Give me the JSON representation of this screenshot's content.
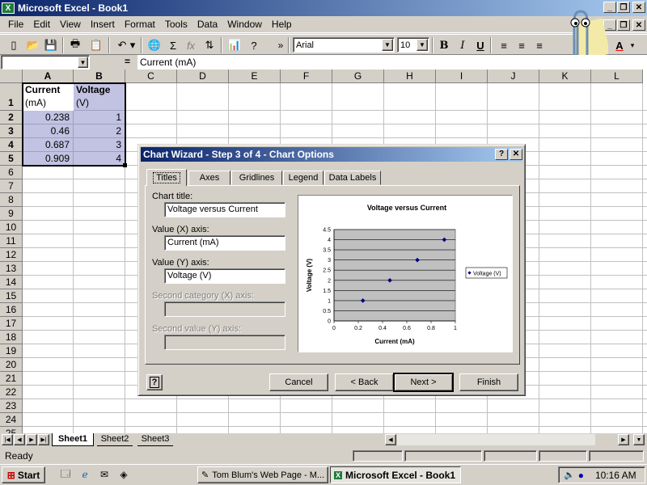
{
  "window": {
    "title": "Microsoft Excel - Book1"
  },
  "menu": [
    "File",
    "Edit",
    "View",
    "Insert",
    "Format",
    "Tools",
    "Data",
    "Window",
    "Help"
  ],
  "toolbar": {
    "font": "Arial",
    "size": "10",
    "bold": "B",
    "italic": "I",
    "underline": "U",
    "sigma": "Σ",
    "fx": "fx",
    "overflow": "»"
  },
  "formula": {
    "name_box": "",
    "equals": "=",
    "content": "Current (mA)"
  },
  "sheet": {
    "columns": [
      "A",
      "B",
      "C",
      "D",
      "E",
      "F",
      "G",
      "H",
      "I",
      "J",
      "K",
      "L"
    ],
    "rows": [
      "1",
      "2",
      "3",
      "4",
      "5",
      "6",
      "7",
      "8",
      "9",
      "10",
      "11",
      "12",
      "13",
      "14",
      "15",
      "16",
      "17",
      "18",
      "19",
      "20",
      "21",
      "22",
      "23",
      "24",
      "25"
    ],
    "headers": {
      "a1_line1": "Current",
      "a1_line2": "(mA)",
      "b1_line1": "Voltage",
      "b1_line2": "(V)"
    },
    "data": [
      {
        "a": "0.238",
        "b": "1"
      },
      {
        "a": "0.46",
        "b": "2"
      },
      {
        "a": "0.687",
        "b": "3"
      },
      {
        "a": "0.909",
        "b": "4"
      }
    ],
    "tabs": [
      "Sheet1",
      "Sheet2",
      "Sheet3"
    ]
  },
  "status": {
    "text": "Ready"
  },
  "dialog": {
    "title": "Chart Wizard - Step 3 of 4 - Chart Options",
    "help_btn": "?",
    "close_btn": "✕",
    "tabs": [
      "Titles",
      "Axes",
      "Gridlines",
      "Legend",
      "Data Labels"
    ],
    "fields": {
      "chart_title_label": "Chart title:",
      "chart_title_value": "Voltage versus Current",
      "x_label": "Value (X) axis:",
      "x_value": "Current (mA)",
      "y_label": "Value (Y) axis:",
      "y_value": "Voltage (V)",
      "x2_label": "Second category (X) axis:",
      "y2_label": "Second value (Y) axis:"
    },
    "buttons": {
      "cancel": "Cancel",
      "back": "< Back",
      "next": "Next >",
      "finish": "Finish"
    }
  },
  "chart_data": {
    "type": "scatter",
    "title": "Voltage versus Current",
    "xlabel": "Current (mA)",
    "ylabel": "Voltage (V)",
    "xlim": [
      0,
      1
    ],
    "ylim": [
      0,
      4.5
    ],
    "x_ticks": [
      "0",
      "0.2",
      "0.4",
      "0.6",
      "0.8",
      "1"
    ],
    "y_ticks": [
      "0",
      "0.5",
      "1",
      "1.5",
      "2",
      "2.5",
      "3",
      "3.5",
      "4",
      "4.5"
    ],
    "grid": true,
    "legend_position": "right",
    "series": [
      {
        "name": "Voltage (V)",
        "x": [
          0.238,
          0.46,
          0.687,
          0.909
        ],
        "y": [
          1,
          2,
          3,
          4
        ],
        "color": "#000080"
      }
    ]
  },
  "taskbar": {
    "start": "Start",
    "items": [
      "Tom Blum's Web Page - M...",
      "Microsoft Excel - Book1"
    ],
    "clock": "10:16 AM"
  }
}
